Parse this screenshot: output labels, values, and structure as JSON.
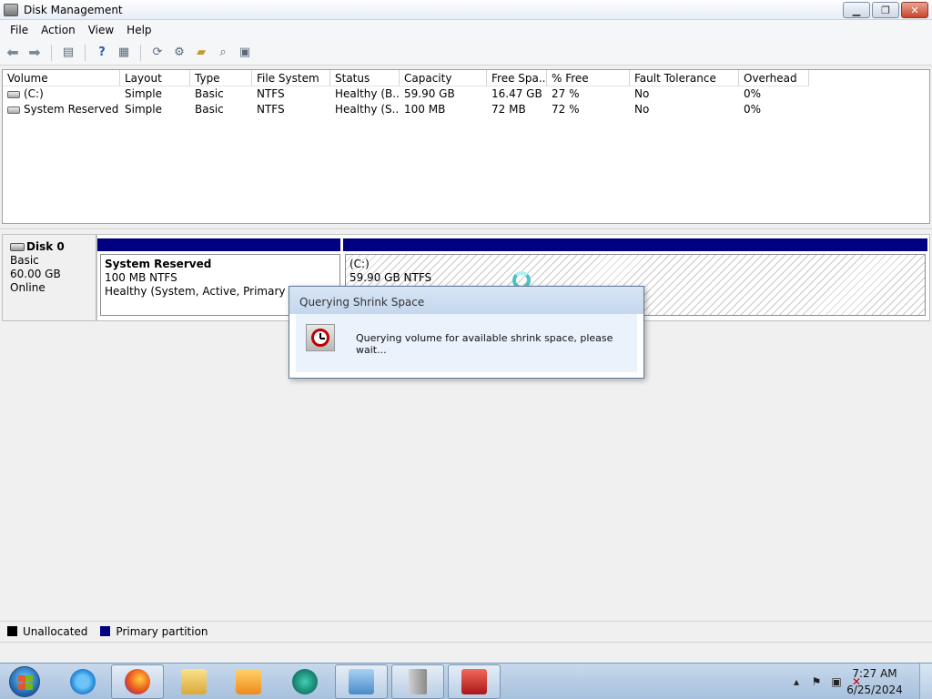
{
  "window": {
    "title": "Disk Management"
  },
  "menu": [
    "File",
    "Action",
    "View",
    "Help"
  ],
  "volumes": {
    "columns": [
      "Volume",
      "Layout",
      "Type",
      "File System",
      "Status",
      "Capacity",
      "Free Spa...",
      "% Free",
      "Fault Tolerance",
      "Overhead"
    ],
    "rows": [
      [
        "(C:)",
        "Simple",
        "Basic",
        "NTFS",
        "Healthy (B...",
        "59.90 GB",
        "16.47 GB",
        "27 %",
        "No",
        "0%"
      ],
      [
        "System Reserved",
        "Simple",
        "Basic",
        "NTFS",
        "Healthy (S...",
        "100 MB",
        "72 MB",
        "72 %",
        "No",
        "0%"
      ]
    ]
  },
  "disk": {
    "name": "Disk 0",
    "type": "Basic",
    "size": "60.00 GB",
    "state": "Online",
    "partitions": [
      {
        "name": "System Reserved",
        "size": "100 MB NTFS",
        "status": "Healthy (System, Active, Primary Partition)"
      },
      {
        "name": "(C:)",
        "size": "59.90 GB NTFS"
      }
    ]
  },
  "legend": {
    "unallocated": "Unallocated",
    "primary": "Primary partition"
  },
  "dialog": {
    "title": "Querying Shrink Space",
    "message": "Querying volume for available shrink space, please wait..."
  },
  "taskbar": {
    "time": "7:27 AM",
    "date": "6/25/2024"
  },
  "colors": {
    "primary_partition": "#000080",
    "unallocated": "#000000"
  }
}
